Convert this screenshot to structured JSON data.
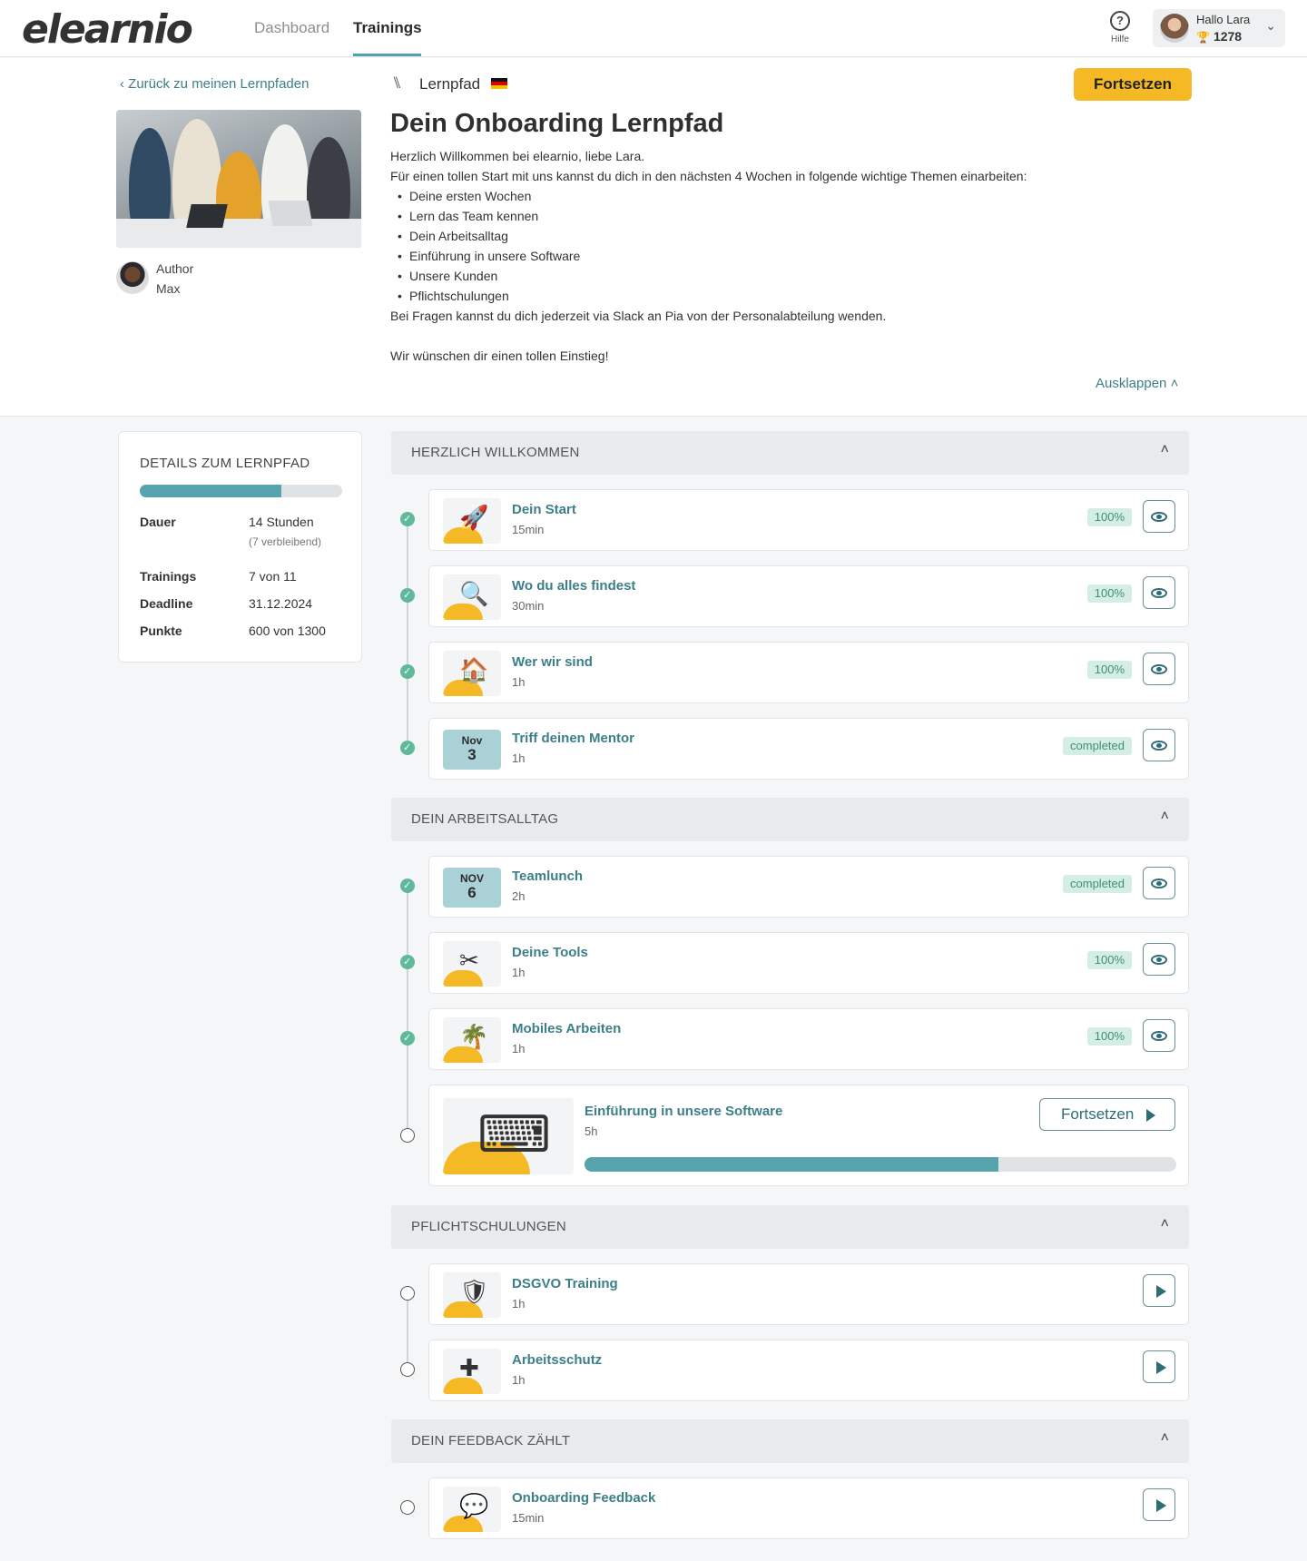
{
  "header": {
    "logo": "elearnio",
    "tabs": [
      "Dashboard",
      "Trainings"
    ],
    "active_tab": "Trainings",
    "help_label": "Hilfe",
    "user_greeting": "Hallo Lara",
    "user_points": "1278"
  },
  "top": {
    "back_link": "Zurück zu meinen Lernpfaden",
    "type_label": "Lernpfad",
    "continue_label": "Fortsetzen",
    "title": "Dein Onboarding Lernpfad",
    "author_label": "Author",
    "author_name": "Max",
    "intro_1": "Herzlich Willkommen bei elearnio, liebe Lara.",
    "intro_2": "Für einen tollen Start mit uns kannst du dich  in den nächsten 4 Wochen in folgende wichtige Themen einarbeiten:",
    "topics": [
      "Deine ersten Wochen",
      "Lern das Team kennen",
      "Dein Arbeitsalltag",
      "Einführung in unsere Software",
      "Unsere Kunden",
      "Pflichtschulungen"
    ],
    "outro_1": "Bei Fragen kannst du dich jederzeit via Slack an Pia von der Personalabteilung wenden.",
    "outro_2": "Wir wünschen dir einen tollen Einstieg!",
    "collapse_label": "Ausklappen"
  },
  "details": {
    "title": "DETAILS ZUM LERNPFAD",
    "progress_fraction": 0.7,
    "duration_label": "Dauer",
    "duration_value": "14 Stunden",
    "duration_remaining": "(7 verbleibend)",
    "trainings_label": "Trainings",
    "trainings_value": "7 von 11",
    "deadline_label": "Deadline",
    "deadline_value": "31.12.2024",
    "points_label": "Punkte",
    "points_value": "600 von 1300"
  },
  "sections": [
    {
      "title": "HERZLICH WILLKOMMEN"
    },
    {
      "title": "DEIN ARBEITSALLTAG"
    },
    {
      "title": "PFLICHTSCHULUNGEN"
    },
    {
      "title": "DEIN FEEDBACK ZÄHLT"
    }
  ],
  "items": [
    {
      "title": "Dein Start",
      "duration": "15min",
      "badge": "100%",
      "icon": "rocket-icon",
      "status": "done"
    },
    {
      "title": "Wo du alles findest",
      "duration": "30min",
      "badge": "100%",
      "icon": "magnifier-icon",
      "status": "done"
    },
    {
      "title": "Wer wir sind",
      "duration": "1h",
      "badge": "100%",
      "icon": "office-icon",
      "status": "done"
    },
    {
      "title": "Triff deinen Mentor",
      "duration": "1h",
      "badge": "completed",
      "month": "Nov",
      "day": "3",
      "status": "done"
    },
    {
      "title": "Teamlunch",
      "duration": "2h",
      "badge": "completed",
      "month": "NOV",
      "day": "6",
      "status": "done"
    },
    {
      "title": "Deine Tools",
      "duration": "1h",
      "badge": "100%",
      "icon": "tools-icon",
      "status": "done"
    },
    {
      "title": "Mobiles Arbeiten",
      "duration": "1h",
      "badge": "100%",
      "icon": "palm-laptop-icon",
      "status": "done"
    },
    {
      "title": "Einführung in unsere Software",
      "duration": "5h",
      "button": "Fortsetzen",
      "progress_fraction": 0.7,
      "icon": "presentation-icon",
      "status": "in-progress"
    },
    {
      "title": "DSGVO Training",
      "duration": "1h",
      "icon": "shield-check-icon",
      "status": "todo"
    },
    {
      "title": "Arbeitsschutz",
      "duration": "1h",
      "icon": "shield-cross-icon",
      "status": "todo"
    },
    {
      "title": "Onboarding Feedback",
      "duration": "15min",
      "icon": "speech-bubbles-icon",
      "status": "todo"
    }
  ],
  "colors": {
    "accent": "#3c7f88",
    "primary_button": "#f6b926",
    "progress": "#57a3ad",
    "done": "#5fb99a"
  }
}
